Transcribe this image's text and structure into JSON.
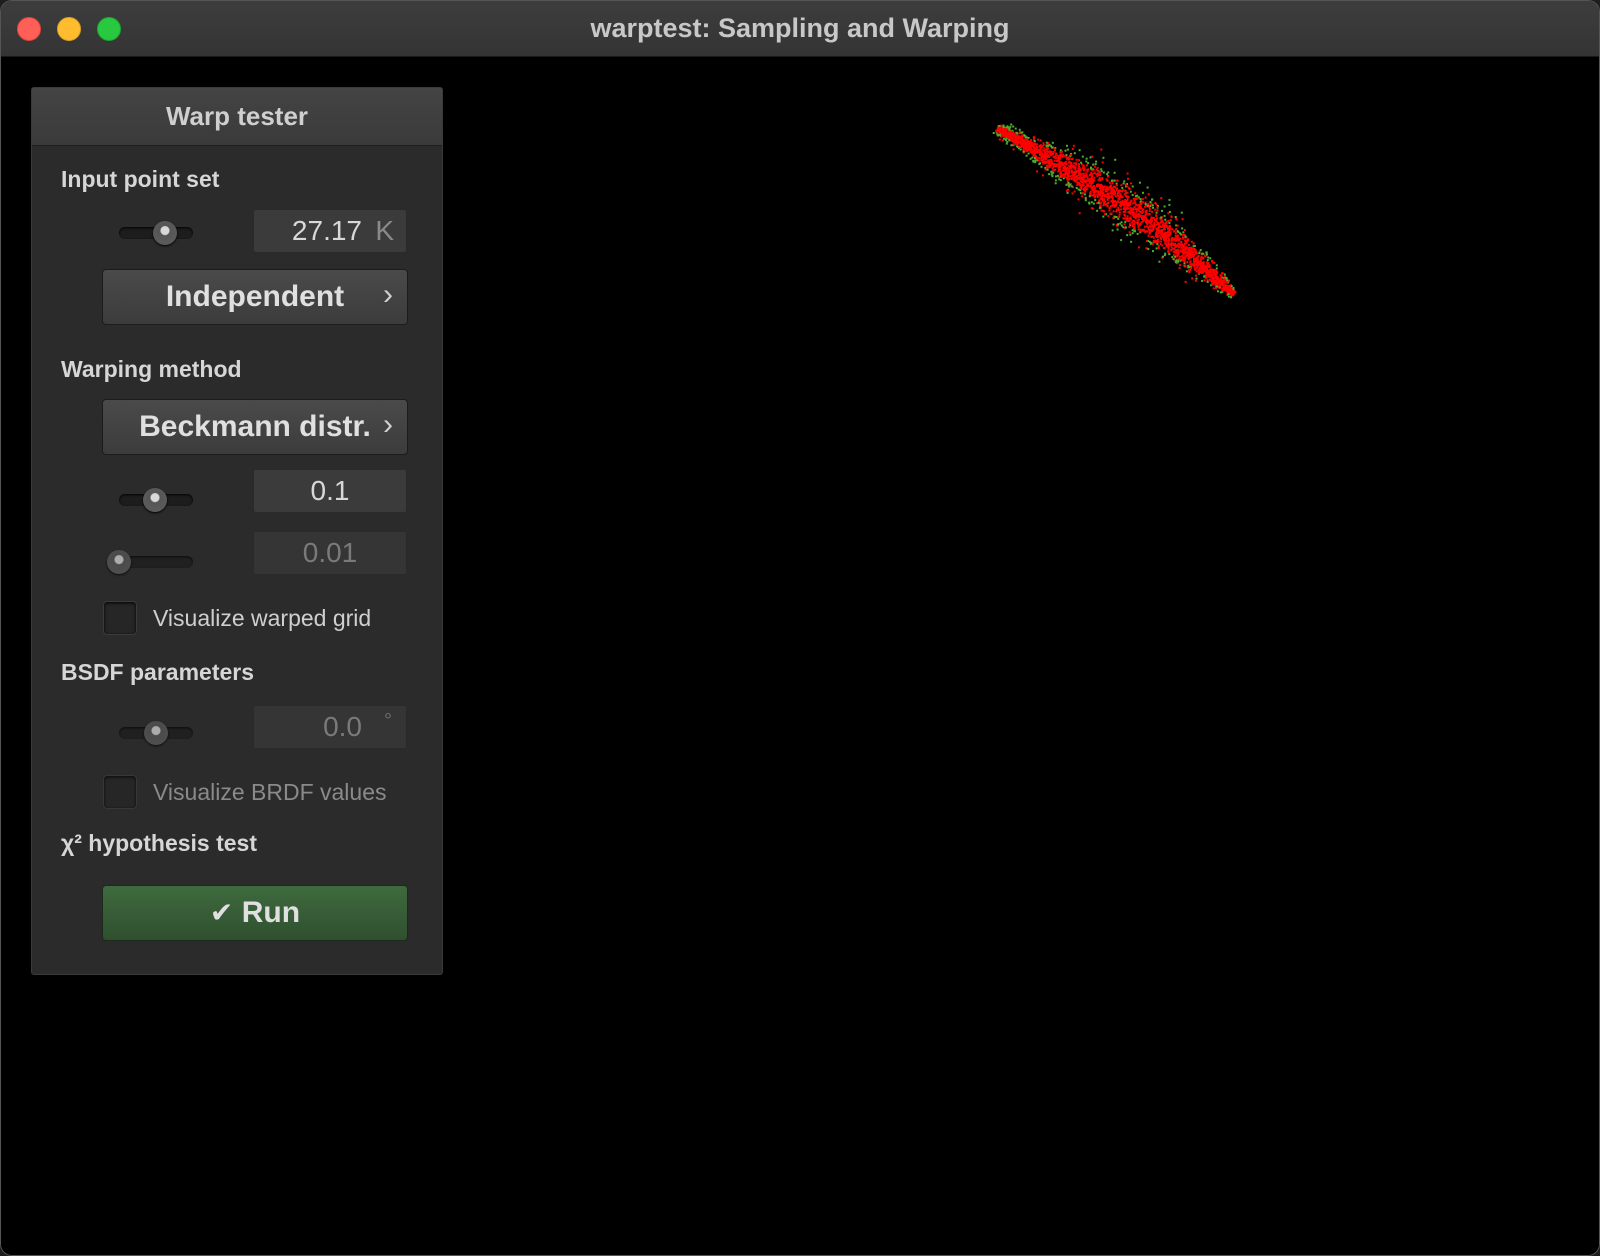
{
  "window": {
    "title": "warptest: Sampling and Warping"
  },
  "panel": {
    "header": "Warp tester",
    "input_point_set": {
      "label": "Input point set",
      "slider_fraction": 0.62,
      "value": "27.17",
      "unit": "K",
      "sampler_button": "Independent"
    },
    "warping_method": {
      "label": "Warping method",
      "method_button": "Beckmann distr.",
      "param1_slider_fraction": 0.48,
      "param1_value": "0.1",
      "param2_slider_fraction": 0.0,
      "param2_value": "0.01",
      "visualize_grid_label": "Visualize warped grid",
      "visualize_grid_checked": false
    },
    "bsdf": {
      "label": "BSDF parameters",
      "angle_slider_fraction": 0.5,
      "angle_value": "0.0",
      "angle_unit": "°",
      "visualize_brdf_label": "Visualize BRDF values",
      "visualize_brdf_checked": false
    },
    "chi2": {
      "label": "χ² hypothesis test",
      "run_button": "Run",
      "run_icon": "check-icon"
    }
  },
  "colors": {
    "accent_green": "#3f6a3e",
    "point_primary": "#ff0000",
    "point_secondary": "#4caf2e",
    "background": "#000000"
  }
}
